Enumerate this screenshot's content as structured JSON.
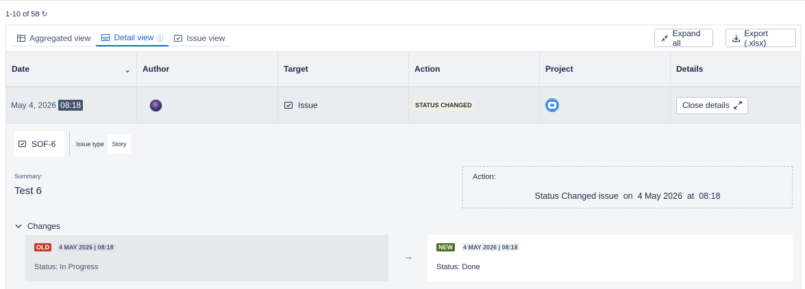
{
  "pagination": {
    "range_label": "1-10 of 58",
    "refresh_icon": "refresh-icon"
  },
  "views": {
    "tabs": [
      {
        "label": "Aggregated view",
        "icon": "table-icon",
        "active": false
      },
      {
        "label": "Detail view",
        "icon": "detail-view-icon",
        "active": true
      },
      {
        "label": "Issue view",
        "icon": "issue-checkbox-icon",
        "active": false
      }
    ],
    "info_icon": "info-icon"
  },
  "toolbar": {
    "expand_all_label": "Expand all",
    "export_label": "Export (.xlsx)"
  },
  "table": {
    "columns": [
      "Date",
      "Author",
      "Target",
      "Action",
      "Project",
      "Details"
    ],
    "row": {
      "date": "May 4, 2026",
      "time": "08:18",
      "author_avatar": "avatar",
      "target": "Issue",
      "action": "STATUS CHANGED",
      "project_icon": "project-icon",
      "details_button": "Close details"
    }
  },
  "details": {
    "issue_key": "SOF-6",
    "issue_type_label": "Issue type",
    "issue_type_value": "Story",
    "summary_label": "Summary:",
    "summary_value": "Test 6",
    "action_label": "Action:",
    "action_text": "Status Changed issue  on  4 May 2026  at  08:18",
    "changes_label": "Changes",
    "old": {
      "tag": "OLD",
      "timestamp": "4 MAY 2026 | 08:18",
      "status": "Status: In Progress"
    },
    "new": {
      "tag": "NEW",
      "timestamp": "4 MAY 2026 | 08:18",
      "status": "Status: Done"
    }
  },
  "colors": {
    "accent": "#0c66e4",
    "old_tag": "#c9372c",
    "new_tag": "#4c6b1f",
    "time_badge": "#44546f"
  }
}
